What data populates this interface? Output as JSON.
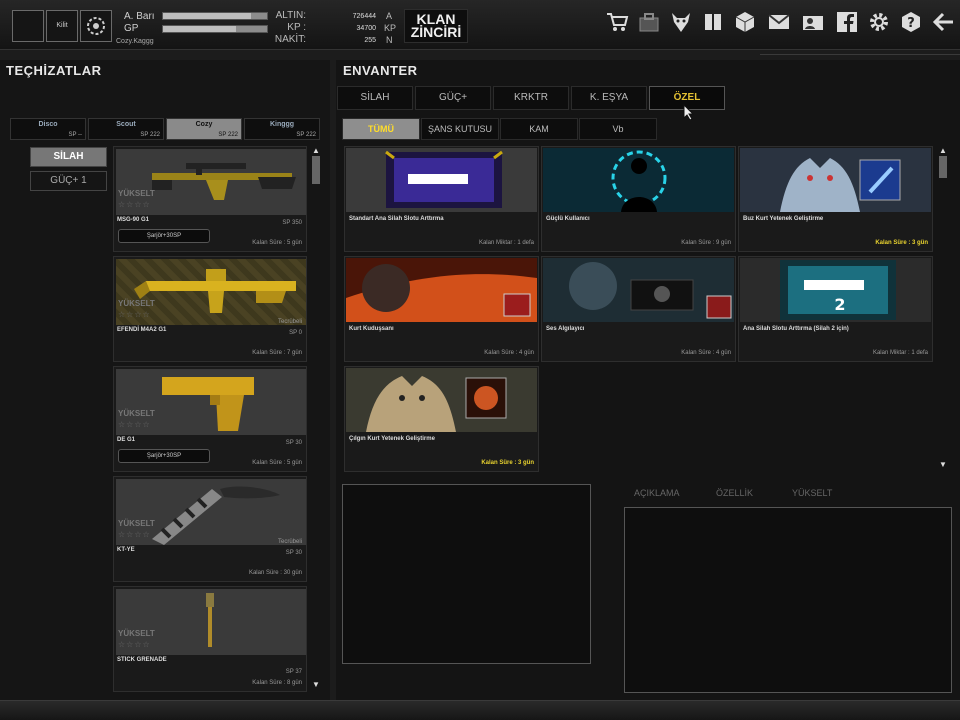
{
  "topbar": {
    "user_name": "A. Barı",
    "gp_label": "GP",
    "char_name": "Cozy.Kaggg",
    "btn1_label": "",
    "btn2_label": "Kilit",
    "altin_label": "ALTIN:",
    "kp_label": "KP :",
    "nakit_label": "NAKİT:",
    "altin_value": "726444",
    "kp_value": "34700",
    "nakit_value": "255",
    "altin_unit": "A",
    "kp_unit": "KP",
    "nakit_unit": "N",
    "klan_line1": "KLAN",
    "klan_line2": "ZİNCİRİ",
    "bar1_fill": 0.85,
    "bar2_fill": 0.7,
    "icons": [
      "cart-icon",
      "bag-icon",
      "wolf-icon",
      "book-icon",
      "box-icon",
      "mail-icon",
      "friends-icon",
      "facebook-icon",
      "gear-icon",
      "help-icon",
      "back-arrow-icon"
    ]
  },
  "left": {
    "title": "TEÇHİZATLAR",
    "char_tabs": [
      {
        "name": "Disco",
        "sp": "SP --"
      },
      {
        "name": "Scout",
        "sp": "SP 222"
      },
      {
        "name": "Cozy",
        "sp": "SP 222"
      },
      {
        "name": "Kinggg",
        "sp": "SP 222"
      }
    ],
    "categories": [
      "SİLAH",
      "GÜÇ+ 1"
    ],
    "equipment": [
      {
        "name": "MSG-90 G1",
        "sp": "SP 350",
        "remaining": "Kalan Süre : 5 gün",
        "sarj": "Şarjör+30SP",
        "upgrade": "YÜKSELT"
      },
      {
        "name": "EFENDİ M4A2 G1",
        "tag": "Tecrübeli",
        "sp": "SP 0",
        "remaining": "Kalan Süre : 7 gün",
        "upgrade": "YÜKSELT"
      },
      {
        "name": "DE G1",
        "sp": "SP 30",
        "remaining": "Kalan Süre : 5 gün",
        "sarj": "Şarjör+30SP",
        "upgrade": "YÜKSELT"
      },
      {
        "name": "KT-YE",
        "tag": "Tecrübeli",
        "sp": "SP 30",
        "remaining": "Kalan Süre : 30 gün",
        "upgrade": "YÜKSELT"
      },
      {
        "name": "STICK GRENADE",
        "sp": "SP 37",
        "remaining": "Kalan Süre : 8 gün",
        "upgrade": "YÜKSELT"
      }
    ],
    "stars": "☆☆☆☆"
  },
  "right": {
    "title": "ENVANTER",
    "tabs": [
      "SİLAH",
      "GÜÇ+",
      "KRKTR",
      "K. EŞYA",
      "ÖZEL"
    ],
    "sub_tabs": [
      "TÜMÜ",
      "ŞANS KUTUSU",
      "KAM",
      "Vb"
    ],
    "items": [
      {
        "name": "Standart Ana Silah Slotu Arttırma",
        "remaining": "Kalan Miktar : 1 defa",
        "highlight": false
      },
      {
        "name": "Güçlü Kullanıcı",
        "remaining": "Kalan Süre : 9 gün",
        "highlight": false
      },
      {
        "name": "Buz Kurt Yetenek Geliştirme",
        "remaining": "Kalan Süre : 3 gün",
        "highlight": true
      },
      {
        "name": "Kurt Kuduşsanı",
        "remaining": "Kalan Süre : 4 gün",
        "highlight": false
      },
      {
        "name": "Ses Algılayıcı",
        "remaining": "Kalan Süre : 4 gün",
        "highlight": false
      },
      {
        "name": "Ana Silah Slotu Arttırma (Silah 2 için)",
        "remaining": "Kalan Miktar : 1 defa",
        "highlight": false
      },
      {
        "name": "Çılgın Kurt Yetenek Geliştirme",
        "remaining": "Kalan Süre : 3 gün",
        "highlight": true
      }
    ],
    "desc_tabs": [
      "AÇIKLAMA",
      "ÖZELLİK",
      "YÜKSELT"
    ]
  }
}
